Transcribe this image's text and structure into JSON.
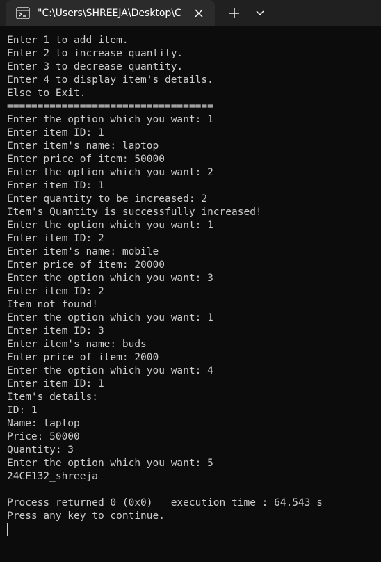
{
  "tab": {
    "title": "\"C:\\Users\\SHREEJA\\Desktop\\C",
    "icon": "console-icon",
    "close_icon": "close-icon"
  },
  "toolbar": {
    "new_tab_icon": "plus-icon",
    "dropdown_icon": "chevron-down-icon"
  },
  "colors": {
    "titlebar": "#202020",
    "tab": "#2b2b2b",
    "terminal_bg": "#0c0c0c",
    "terminal_text": "#cccccc"
  },
  "terminal": {
    "lines": [
      "Enter 1 to add item.",
      "Enter 2 to increase quantity.",
      "Enter 3 to decrease quantity.",
      "Enter 4 to display item's details.",
      "Else to Exit.",
      "==================================",
      "Enter the option which you want: 1",
      "Enter item ID: 1",
      "Enter item's name: laptop",
      "Enter price of item: 50000",
      "Enter the option which you want: 2",
      "Enter item ID: 1",
      "Enter quantity to be increased: 2",
      "Item's Quantity is successfully increased!",
      "Enter the option which you want: 1",
      "Enter item ID: 2",
      "Enter item's name: mobile",
      "Enter price of item: 20000",
      "Enter the option which you want: 3",
      "Enter item ID: 2",
      "Item not found!",
      "Enter the option which you want: 1",
      "Enter item ID: 3",
      "Enter item's name: buds",
      "Enter price of item: 2000",
      "Enter the option which you want: 4",
      "Enter item ID: 1",
      "Item's details:",
      "ID: 1",
      "Name: laptop",
      "Price: 50000",
      "Quantity: 3",
      "Enter the option which you want: 5",
      "24CE132_shreeja",
      "",
      "Process returned 0 (0x0)   execution time : 64.543 s",
      "Press any key to continue."
    ]
  }
}
